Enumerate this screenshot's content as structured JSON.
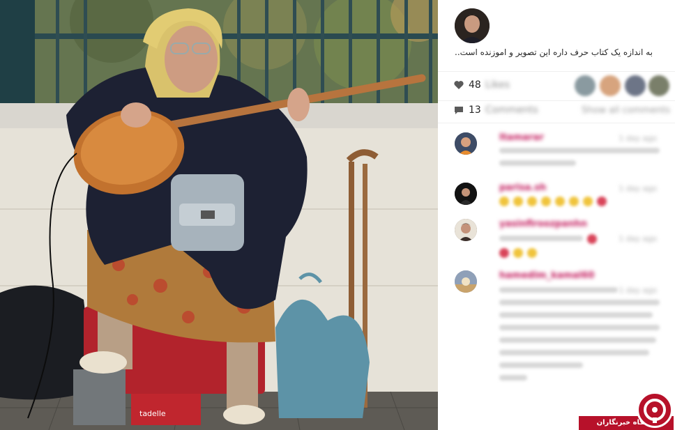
{
  "post": {
    "caption": "به اندازه یک کتاب حرف داره این تصویر و اموزنده است..",
    "photo_alt": ""
  },
  "stats": {
    "likes_count": "48",
    "likes_label": "Likes",
    "comments_count": "13",
    "comments_label": "Comments",
    "show_all": "Show all comments"
  },
  "comments": [
    {
      "user": "Itamarar",
      "time": "1 day ago"
    },
    {
      "user": "parisa.sh",
      "time": "1 day ago"
    },
    {
      "user": "yasinfiroozpanhn",
      "time": "1 day ago"
    },
    {
      "user": "hamedim_kamal60",
      "time": "1 day ago"
    }
  ],
  "photo_text": {
    "box_brand": "tadelle"
  },
  "watermark": {
    "text": "باشگاه خبرنگاران"
  },
  "colors": {
    "accent": "#b7112a",
    "username": "#c2185b",
    "divider": "#efefef"
  },
  "icons": [
    "heart-icon",
    "comment-icon"
  ]
}
